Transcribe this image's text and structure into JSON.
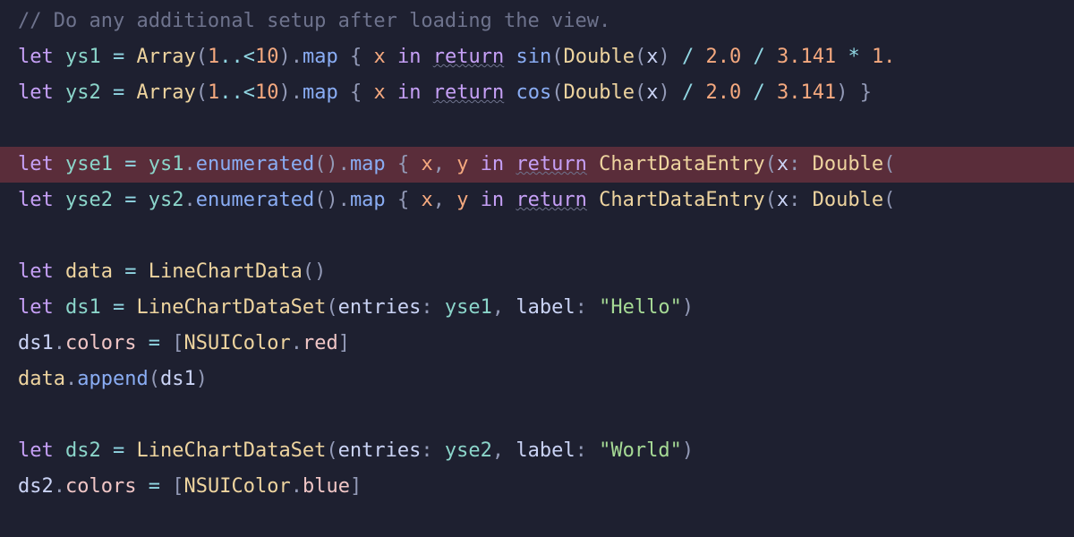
{
  "editor": {
    "lines": [
      {
        "highlighted": false,
        "tokens": [
          {
            "cls": "c-comment",
            "text": "// Do any additional setup after loading the view."
          }
        ]
      },
      {
        "highlighted": false,
        "tokens": [
          {
            "cls": "c-keyword",
            "text": "let"
          },
          {
            "cls": "c-text",
            "text": " "
          },
          {
            "cls": "c-var2",
            "text": "ys1"
          },
          {
            "cls": "c-text",
            "text": " "
          },
          {
            "cls": "c-op",
            "text": "="
          },
          {
            "cls": "c-text",
            "text": " "
          },
          {
            "cls": "c-type",
            "text": "Array"
          },
          {
            "cls": "c-punct",
            "text": "("
          },
          {
            "cls": "c-number",
            "text": "1"
          },
          {
            "cls": "c-op",
            "text": "..<"
          },
          {
            "cls": "c-number",
            "text": "10"
          },
          {
            "cls": "c-punct",
            "text": ")."
          },
          {
            "cls": "c-func",
            "text": "map"
          },
          {
            "cls": "c-text",
            "text": " "
          },
          {
            "cls": "c-punct",
            "text": "{"
          },
          {
            "cls": "c-text",
            "text": " "
          },
          {
            "cls": "c-param",
            "text": "x"
          },
          {
            "cls": "c-text",
            "text": " "
          },
          {
            "cls": "c-keyword",
            "text": "in"
          },
          {
            "cls": "c-text",
            "text": " "
          },
          {
            "cls": "c-keyword wavy",
            "text": "return"
          },
          {
            "cls": "c-text",
            "text": " "
          },
          {
            "cls": "c-func",
            "text": "sin"
          },
          {
            "cls": "c-punct",
            "text": "("
          },
          {
            "cls": "c-type",
            "text": "Double"
          },
          {
            "cls": "c-punct",
            "text": "("
          },
          {
            "cls": "c-text",
            "text": "x"
          },
          {
            "cls": "c-punct",
            "text": ")"
          },
          {
            "cls": "c-text",
            "text": " "
          },
          {
            "cls": "c-op",
            "text": "/"
          },
          {
            "cls": "c-text",
            "text": " "
          },
          {
            "cls": "c-number",
            "text": "2.0"
          },
          {
            "cls": "c-text",
            "text": " "
          },
          {
            "cls": "c-op",
            "text": "/"
          },
          {
            "cls": "c-text",
            "text": " "
          },
          {
            "cls": "c-number",
            "text": "3.141"
          },
          {
            "cls": "c-text",
            "text": " "
          },
          {
            "cls": "c-op",
            "text": "*"
          },
          {
            "cls": "c-text",
            "text": " "
          },
          {
            "cls": "c-number",
            "text": "1."
          }
        ]
      },
      {
        "highlighted": false,
        "tokens": [
          {
            "cls": "c-keyword",
            "text": "let"
          },
          {
            "cls": "c-text",
            "text": " "
          },
          {
            "cls": "c-var2",
            "text": "ys2"
          },
          {
            "cls": "c-text",
            "text": " "
          },
          {
            "cls": "c-op",
            "text": "="
          },
          {
            "cls": "c-text",
            "text": " "
          },
          {
            "cls": "c-type",
            "text": "Array"
          },
          {
            "cls": "c-punct",
            "text": "("
          },
          {
            "cls": "c-number",
            "text": "1"
          },
          {
            "cls": "c-op",
            "text": "..<"
          },
          {
            "cls": "c-number",
            "text": "10"
          },
          {
            "cls": "c-punct",
            "text": ")."
          },
          {
            "cls": "c-func",
            "text": "map"
          },
          {
            "cls": "c-text",
            "text": " "
          },
          {
            "cls": "c-punct",
            "text": "{"
          },
          {
            "cls": "c-text",
            "text": " "
          },
          {
            "cls": "c-param",
            "text": "x"
          },
          {
            "cls": "c-text",
            "text": " "
          },
          {
            "cls": "c-keyword",
            "text": "in"
          },
          {
            "cls": "c-text",
            "text": " "
          },
          {
            "cls": "c-keyword wavy",
            "text": "return"
          },
          {
            "cls": "c-text",
            "text": " "
          },
          {
            "cls": "c-func",
            "text": "cos"
          },
          {
            "cls": "c-punct",
            "text": "("
          },
          {
            "cls": "c-type",
            "text": "Double"
          },
          {
            "cls": "c-punct",
            "text": "("
          },
          {
            "cls": "c-text",
            "text": "x"
          },
          {
            "cls": "c-punct",
            "text": ")"
          },
          {
            "cls": "c-text",
            "text": " "
          },
          {
            "cls": "c-op",
            "text": "/"
          },
          {
            "cls": "c-text",
            "text": " "
          },
          {
            "cls": "c-number",
            "text": "2.0"
          },
          {
            "cls": "c-text",
            "text": " "
          },
          {
            "cls": "c-op",
            "text": "/"
          },
          {
            "cls": "c-text",
            "text": " "
          },
          {
            "cls": "c-number",
            "text": "3.141"
          },
          {
            "cls": "c-punct",
            "text": ")"
          },
          {
            "cls": "c-text",
            "text": " "
          },
          {
            "cls": "c-punct",
            "text": "}"
          }
        ]
      },
      {
        "highlighted": false,
        "tokens": []
      },
      {
        "highlighted": true,
        "tokens": [
          {
            "cls": "c-keyword",
            "text": "let"
          },
          {
            "cls": "c-text",
            "text": " "
          },
          {
            "cls": "c-var2",
            "text": "yse1"
          },
          {
            "cls": "c-text",
            "text": " "
          },
          {
            "cls": "c-op",
            "text": "="
          },
          {
            "cls": "c-text",
            "text": " "
          },
          {
            "cls": "c-var2",
            "text": "ys1"
          },
          {
            "cls": "c-punct",
            "text": "."
          },
          {
            "cls": "c-func",
            "text": "enumerated"
          },
          {
            "cls": "c-punct",
            "text": "()."
          },
          {
            "cls": "c-func",
            "text": "map"
          },
          {
            "cls": "c-text",
            "text": " "
          },
          {
            "cls": "c-punct",
            "text": "{"
          },
          {
            "cls": "c-text",
            "text": " "
          },
          {
            "cls": "c-param",
            "text": "x"
          },
          {
            "cls": "c-punct",
            "text": ","
          },
          {
            "cls": "c-text",
            "text": " "
          },
          {
            "cls": "c-param",
            "text": "y"
          },
          {
            "cls": "c-text",
            "text": " "
          },
          {
            "cls": "c-keyword",
            "text": "in"
          },
          {
            "cls": "c-text",
            "text": " "
          },
          {
            "cls": "c-keyword wavy",
            "text": "return"
          },
          {
            "cls": "c-text",
            "text": " "
          },
          {
            "cls": "c-type",
            "text": "ChartDataEntry"
          },
          {
            "cls": "c-punct",
            "text": "("
          },
          {
            "cls": "c-text",
            "text": "x"
          },
          {
            "cls": "c-punct",
            "text": ":"
          },
          {
            "cls": "c-text",
            "text": " "
          },
          {
            "cls": "c-type",
            "text": "Double"
          },
          {
            "cls": "c-punct",
            "text": "("
          }
        ]
      },
      {
        "highlighted": false,
        "tokens": [
          {
            "cls": "c-keyword",
            "text": "let"
          },
          {
            "cls": "c-text",
            "text": " "
          },
          {
            "cls": "c-var2",
            "text": "yse2"
          },
          {
            "cls": "c-text",
            "text": " "
          },
          {
            "cls": "c-op",
            "text": "="
          },
          {
            "cls": "c-text",
            "text": " "
          },
          {
            "cls": "c-var2",
            "text": "ys2"
          },
          {
            "cls": "c-punct",
            "text": "."
          },
          {
            "cls": "c-func",
            "text": "enumerated"
          },
          {
            "cls": "c-punct",
            "text": "()."
          },
          {
            "cls": "c-func",
            "text": "map"
          },
          {
            "cls": "c-text",
            "text": " "
          },
          {
            "cls": "c-punct",
            "text": "{"
          },
          {
            "cls": "c-text",
            "text": " "
          },
          {
            "cls": "c-param",
            "text": "x"
          },
          {
            "cls": "c-punct",
            "text": ","
          },
          {
            "cls": "c-text",
            "text": " "
          },
          {
            "cls": "c-param",
            "text": "y"
          },
          {
            "cls": "c-text",
            "text": " "
          },
          {
            "cls": "c-keyword",
            "text": "in"
          },
          {
            "cls": "c-text",
            "text": " "
          },
          {
            "cls": "c-keyword wavy",
            "text": "return"
          },
          {
            "cls": "c-text",
            "text": " "
          },
          {
            "cls": "c-type",
            "text": "ChartDataEntry"
          },
          {
            "cls": "c-punct",
            "text": "("
          },
          {
            "cls": "c-text",
            "text": "x"
          },
          {
            "cls": "c-punct",
            "text": ":"
          },
          {
            "cls": "c-text",
            "text": " "
          },
          {
            "cls": "c-type",
            "text": "Double"
          },
          {
            "cls": "c-punct",
            "text": "("
          }
        ]
      },
      {
        "highlighted": false,
        "tokens": []
      },
      {
        "highlighted": false,
        "tokens": [
          {
            "cls": "c-keyword",
            "text": "let"
          },
          {
            "cls": "c-text",
            "text": " "
          },
          {
            "cls": "c-var1",
            "text": "data"
          },
          {
            "cls": "c-text",
            "text": " "
          },
          {
            "cls": "c-op",
            "text": "="
          },
          {
            "cls": "c-text",
            "text": " "
          },
          {
            "cls": "c-type",
            "text": "LineChartData"
          },
          {
            "cls": "c-punct",
            "text": "()"
          }
        ]
      },
      {
        "highlighted": false,
        "tokens": [
          {
            "cls": "c-keyword",
            "text": "let"
          },
          {
            "cls": "c-text",
            "text": " "
          },
          {
            "cls": "c-var2",
            "text": "ds1"
          },
          {
            "cls": "c-text",
            "text": " "
          },
          {
            "cls": "c-op",
            "text": "="
          },
          {
            "cls": "c-text",
            "text": " "
          },
          {
            "cls": "c-type",
            "text": "LineChartDataSet"
          },
          {
            "cls": "c-punct",
            "text": "("
          },
          {
            "cls": "c-text",
            "text": "entries"
          },
          {
            "cls": "c-punct",
            "text": ":"
          },
          {
            "cls": "c-text",
            "text": " "
          },
          {
            "cls": "c-var2",
            "text": "yse1"
          },
          {
            "cls": "c-punct",
            "text": ","
          },
          {
            "cls": "c-text",
            "text": " label"
          },
          {
            "cls": "c-punct",
            "text": ":"
          },
          {
            "cls": "c-text",
            "text": " "
          },
          {
            "cls": "c-string",
            "text": "\"Hello\""
          },
          {
            "cls": "c-punct",
            "text": ")"
          }
        ]
      },
      {
        "highlighted": false,
        "tokens": [
          {
            "cls": "c-text",
            "text": "ds1"
          },
          {
            "cls": "c-punct",
            "text": "."
          },
          {
            "cls": "c-member",
            "text": "colors"
          },
          {
            "cls": "c-text",
            "text": " "
          },
          {
            "cls": "c-op",
            "text": "="
          },
          {
            "cls": "c-text",
            "text": " "
          },
          {
            "cls": "c-punct",
            "text": "["
          },
          {
            "cls": "c-type",
            "text": "NSUIColor"
          },
          {
            "cls": "c-punct",
            "text": "."
          },
          {
            "cls": "c-member",
            "text": "red"
          },
          {
            "cls": "c-punct",
            "text": "]"
          }
        ]
      },
      {
        "highlighted": false,
        "tokens": [
          {
            "cls": "c-var1",
            "text": "data"
          },
          {
            "cls": "c-punct",
            "text": "."
          },
          {
            "cls": "c-func",
            "text": "append"
          },
          {
            "cls": "c-punct",
            "text": "("
          },
          {
            "cls": "c-text",
            "text": "ds1"
          },
          {
            "cls": "c-punct",
            "text": ")"
          }
        ]
      },
      {
        "highlighted": false,
        "tokens": []
      },
      {
        "highlighted": false,
        "tokens": [
          {
            "cls": "c-keyword",
            "text": "let"
          },
          {
            "cls": "c-text",
            "text": " "
          },
          {
            "cls": "c-var2",
            "text": "ds2"
          },
          {
            "cls": "c-text",
            "text": " "
          },
          {
            "cls": "c-op",
            "text": "="
          },
          {
            "cls": "c-text",
            "text": " "
          },
          {
            "cls": "c-type",
            "text": "LineChartDataSet"
          },
          {
            "cls": "c-punct",
            "text": "("
          },
          {
            "cls": "c-text",
            "text": "entries"
          },
          {
            "cls": "c-punct",
            "text": ":"
          },
          {
            "cls": "c-text",
            "text": " "
          },
          {
            "cls": "c-var2",
            "text": "yse2"
          },
          {
            "cls": "c-punct",
            "text": ","
          },
          {
            "cls": "c-text",
            "text": " label"
          },
          {
            "cls": "c-punct",
            "text": ":"
          },
          {
            "cls": "c-text",
            "text": " "
          },
          {
            "cls": "c-string",
            "text": "\"World\""
          },
          {
            "cls": "c-punct",
            "text": ")"
          }
        ]
      },
      {
        "highlighted": false,
        "tokens": [
          {
            "cls": "c-text",
            "text": "ds2"
          },
          {
            "cls": "c-punct",
            "text": "."
          },
          {
            "cls": "c-member",
            "text": "colors"
          },
          {
            "cls": "c-text",
            "text": " "
          },
          {
            "cls": "c-op",
            "text": "="
          },
          {
            "cls": "c-text",
            "text": " "
          },
          {
            "cls": "c-punct",
            "text": "["
          },
          {
            "cls": "c-type",
            "text": "NSUIColor"
          },
          {
            "cls": "c-punct",
            "text": "."
          },
          {
            "cls": "c-member",
            "text": "blue"
          },
          {
            "cls": "c-punct",
            "text": "]"
          }
        ]
      }
    ]
  }
}
